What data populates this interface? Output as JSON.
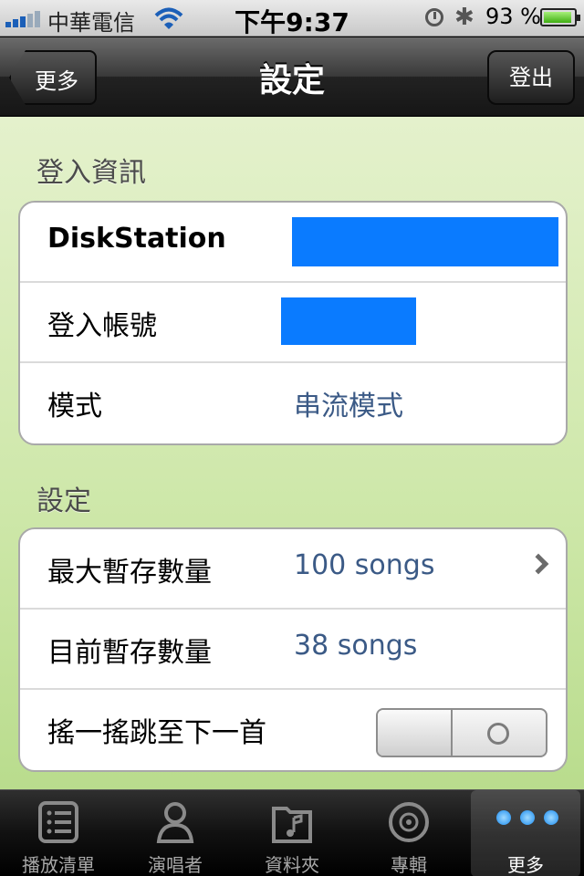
{
  "status_bar": {
    "carrier": "中華電信",
    "time": "下午9:37",
    "battery_percent": "93 %"
  },
  "nav": {
    "back_label": "更多",
    "title": "設定",
    "logout_label": "登出"
  },
  "login_section": {
    "header": "登入資訊",
    "rows": [
      {
        "label": "DiskStation",
        "value": ""
      },
      {
        "label": "登入帳號",
        "value": ""
      },
      {
        "label": "模式",
        "value": "串流模式"
      }
    ]
  },
  "settings_section": {
    "header": "設定",
    "rows": [
      {
        "label": "最大暫存數量",
        "value": "100 songs"
      },
      {
        "label": "目前暫存數量",
        "value": "38 songs"
      },
      {
        "label": "搖一搖跳至下一首",
        "value": "",
        "toggle_on": false
      }
    ]
  },
  "tabs": [
    {
      "label": "播放清單",
      "icon": "playlist-icon"
    },
    {
      "label": "演唱者",
      "icon": "artist-icon"
    },
    {
      "label": "資料夾",
      "icon": "folder-icon"
    },
    {
      "label": "專輯",
      "icon": "album-icon"
    },
    {
      "label": "更多",
      "icon": "more-icon",
      "active": true
    }
  ],
  "colors": {
    "accent_value": "#3b5a86",
    "redaction": "#0a7bff",
    "background_green": "#cde7a8"
  }
}
